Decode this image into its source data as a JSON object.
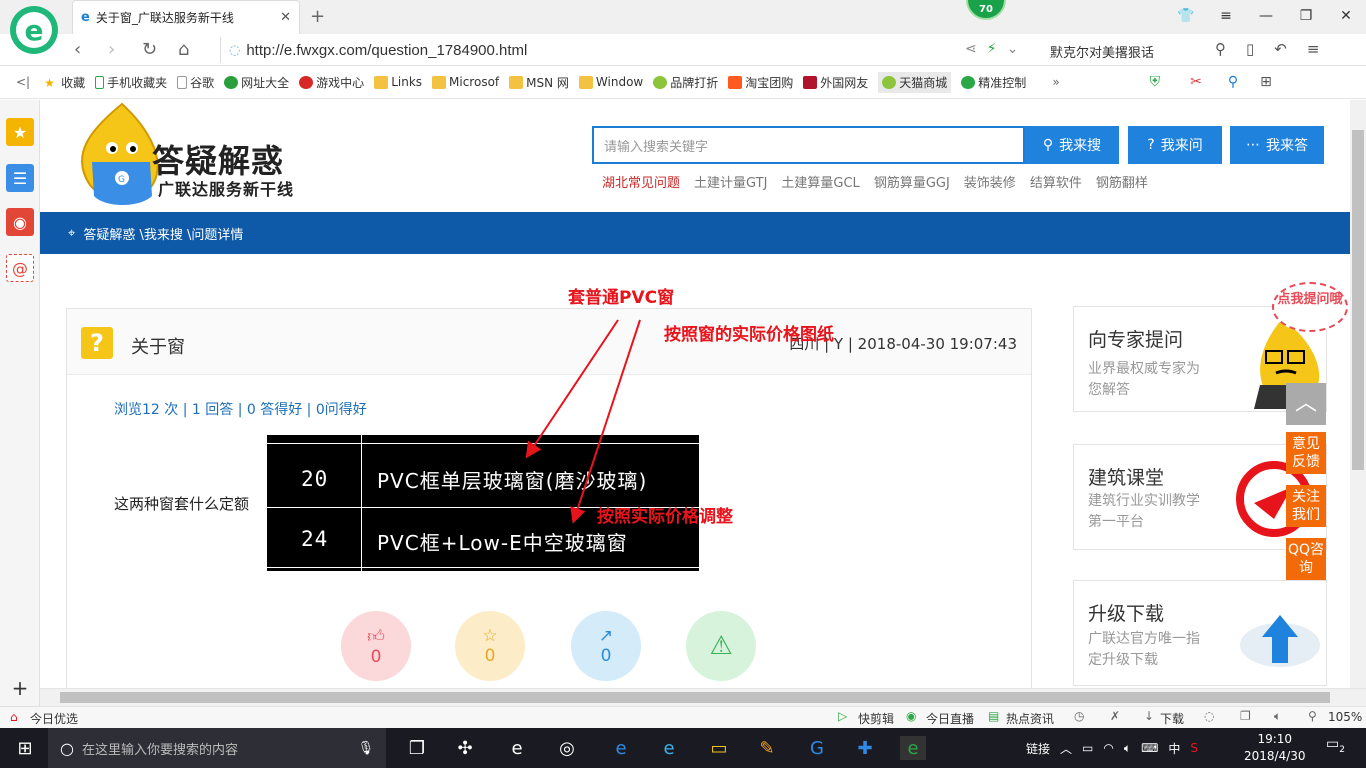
{
  "browser": {
    "tab_title": "关于窗_广联达服务新干线",
    "url": "http://e.fwxgx.com/question_1784900.html",
    "badge": "70",
    "search_text": "默克尔对美撂狠话",
    "zoom": "105%"
  },
  "bookmarks": [
    "收藏",
    "手机收藏夹",
    "谷歌",
    "网址大全",
    "游戏中心",
    "Links",
    "Microsof",
    "MSN 网",
    "Window",
    "品牌打折",
    "淘宝团购",
    "外国网友",
    "天猫商城",
    "精准控制"
  ],
  "header": {
    "brand": "答疑解惑",
    "brand_sub": "广联达服务新干线",
    "search_placeholder": "请输入搜索关键字",
    "btn_search": "我来搜",
    "btn_ask": "我来问",
    "btn_answer": "我来答",
    "hot_links": [
      "湖北常见问题",
      "土建计量GTJ",
      "土建算量GCL",
      "钢筋算量GGJ",
      "装饰装修",
      "结算软件",
      "钢筋翻样"
    ]
  },
  "breadcrumb": "答疑解惑 \\我来搜 \\问题详情",
  "question": {
    "title": "关于窗",
    "meta": "四川 | Y | 2018-04-30 19:07:43",
    "stats": "浏览12 次 | 1 回答 | 0 答得好 | 0问得好",
    "text": "这两种窗套什么定额",
    "cad_rows": [
      {
        "num": "20",
        "text": "PVC框单层玻璃窗(磨沙玻璃)"
      },
      {
        "num": "24",
        "text": "PVC框+Low-E中空玻璃窗"
      }
    ],
    "actions": [
      {
        "name": "like",
        "count": "0"
      },
      {
        "name": "fav",
        "count": "0"
      },
      {
        "name": "share",
        "count": "0"
      },
      {
        "name": "report",
        "count": ""
      }
    ]
  },
  "annotations": {
    "a1": "套普通PVC窗",
    "a2": "按照窗的实际价格图纸",
    "a3": "按照实际价格调整"
  },
  "right": {
    "boxes": [
      {
        "title": "向专家提问",
        "sub": "业界最权威专家为您解答"
      },
      {
        "title": "建筑课堂",
        "sub": "建筑行业实训教学第一平台"
      },
      {
        "title": "升级下载",
        "sub": "广联达官方唯一指定升级下载"
      }
    ],
    "bubble": "点我提问哦",
    "float_buttons": [
      "意见反馈",
      "关注我们",
      "QQ咨询"
    ]
  },
  "statusbar": {
    "left": "今日优选",
    "items": [
      "快剪辑",
      "今日直播",
      "热点资讯",
      "下载"
    ]
  },
  "taskbar": {
    "search_placeholder": "在这里输入你要搜索的内容",
    "tray_link": "链接",
    "ime": "中",
    "time": "19:10",
    "date": "2018/4/30",
    "notif": "2"
  }
}
